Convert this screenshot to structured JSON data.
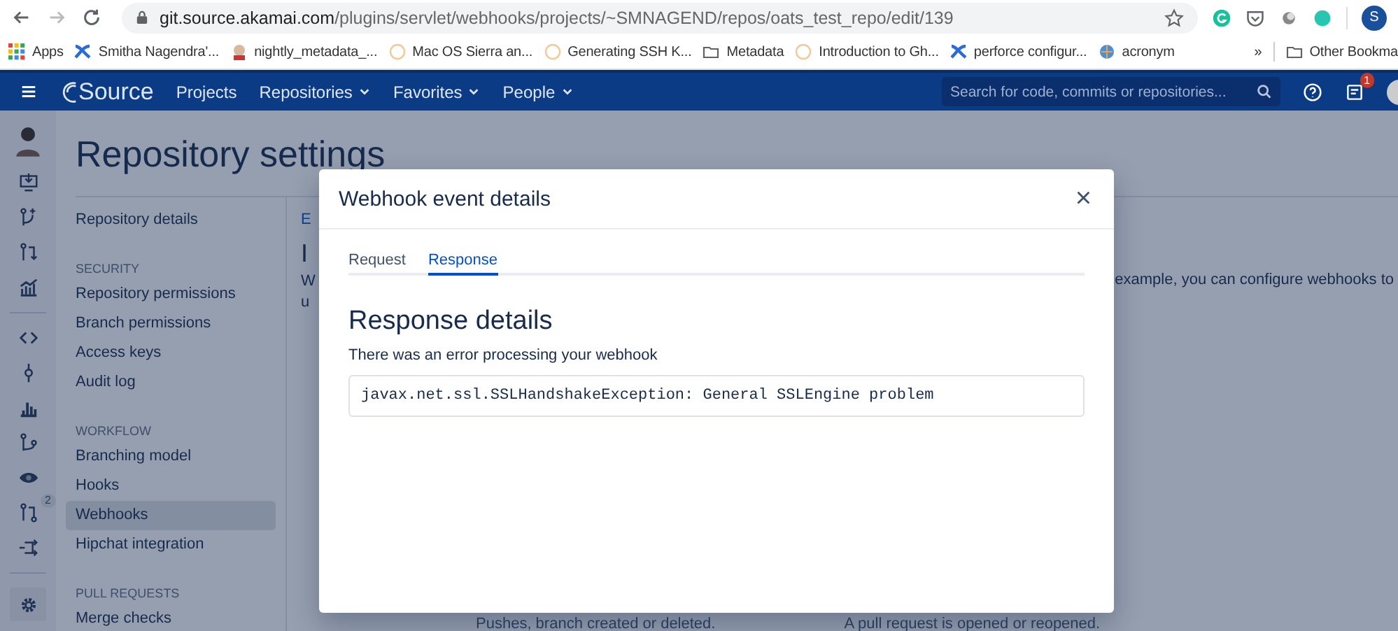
{
  "browser": {
    "url_host": "git.source.akamai.com",
    "url_path": "/plugins/servlet/webhooks/projects/~SMNAGEND/repos/oats_test_repo/edit/139",
    "profile_initial": "S",
    "bookmarks": [
      {
        "label": "Apps",
        "kind": "apps"
      },
      {
        "label": "Smitha Nagendra'...",
        "kind": "confluence"
      },
      {
        "label": "nightly_metadata_...",
        "kind": "jenkins"
      },
      {
        "label": "Mac OS Sierra an...",
        "kind": "circle"
      },
      {
        "label": "Generating SSH K...",
        "kind": "circle"
      },
      {
        "label": "Metadata",
        "kind": "folder"
      },
      {
        "label": "Introduction to Gh...",
        "kind": "circle"
      },
      {
        "label": "perforce configur...",
        "kind": "confluence"
      },
      {
        "label": "acronym",
        "kind": "globe"
      }
    ],
    "overflow": "»",
    "other_bookmarks": "Other Bookma"
  },
  "header": {
    "logo": "Source",
    "nav": [
      {
        "label": "Projects",
        "dropdown": false
      },
      {
        "label": "Repositories",
        "dropdown": true
      },
      {
        "label": "Favorites",
        "dropdown": true
      },
      {
        "label": "People",
        "dropdown": true
      }
    ],
    "search": {
      "placeholder": "Search for code, commits or repositories..."
    },
    "notification_count": "1"
  },
  "rail": {
    "pull_request_count": "2"
  },
  "page": {
    "title": "Repository settings",
    "sidebar": [
      {
        "kind": "item",
        "label": "Repository details",
        "selected": false
      },
      {
        "kind": "section",
        "label": "SECURITY"
      },
      {
        "kind": "item",
        "label": "Repository permissions",
        "selected": false
      },
      {
        "kind": "item",
        "label": "Branch permissions",
        "selected": false
      },
      {
        "kind": "item",
        "label": "Access keys",
        "selected": false
      },
      {
        "kind": "item",
        "label": "Audit log",
        "selected": false
      },
      {
        "kind": "section",
        "label": "WORKFLOW"
      },
      {
        "kind": "item",
        "label": "Branching model",
        "selected": false
      },
      {
        "kind": "item",
        "label": "Hooks",
        "selected": false
      },
      {
        "kind": "item",
        "label": "Webhooks",
        "selected": true
      },
      {
        "kind": "item",
        "label": "Hipchat integration",
        "selected": false
      },
      {
        "kind": "section",
        "label": "PULL REQUESTS"
      },
      {
        "kind": "item",
        "label": "Merge checks",
        "selected": false
      }
    ],
    "breadcrumb": "E",
    "heading": "I",
    "intro_left": [
      "W",
      "u"
    ],
    "intro_right": "example, you can configure webhooks to",
    "events": [
      "Pushes, branch created or deleted.",
      "A pull request is opened or reopened."
    ]
  },
  "modal": {
    "title": "Webhook event details",
    "close": "×",
    "tabs": [
      {
        "label": "Request",
        "selected": false
      },
      {
        "label": "Response",
        "selected": true
      }
    ],
    "heading": "Response details",
    "message": "There was an error processing your webhook",
    "output": "javax.net.ssl.SSLHandshakeException: General SSLEngine problem"
  }
}
